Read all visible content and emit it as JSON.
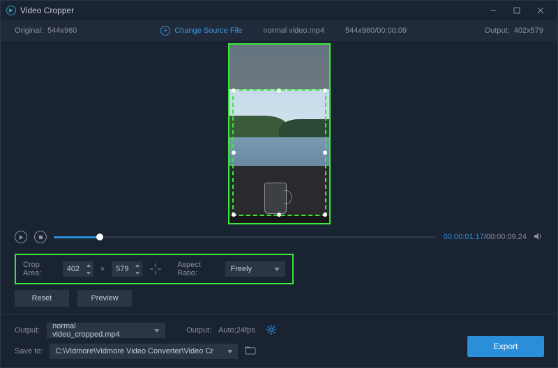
{
  "window": {
    "title": "Video Cropper"
  },
  "info": {
    "original_label": "Original:",
    "original_dims": "544x960",
    "change_source": "Change Source File",
    "filename": "normal video.mp4",
    "src_meta": "544x960/00:00:09",
    "output_label": "Output:",
    "output_dims": "402x579"
  },
  "playback": {
    "current": "00:00:01.17",
    "total": "/00:00:09.24"
  },
  "crop": {
    "label": "Crop Area:",
    "width": "402",
    "sep": "×",
    "height": "579",
    "aspect_label": "Aspect Ratio:",
    "aspect_value": "Freely"
  },
  "buttons": {
    "reset": "Reset",
    "preview": "Preview",
    "export": "Export"
  },
  "output": {
    "label1": "Output:",
    "filename": "normal video_cropped.mp4",
    "label2": "Output:",
    "format": "Auto;24fps",
    "save_label": "Save to:",
    "save_path": "C:\\Vidmore\\Vidmore Video Converter\\Video Crop"
  }
}
